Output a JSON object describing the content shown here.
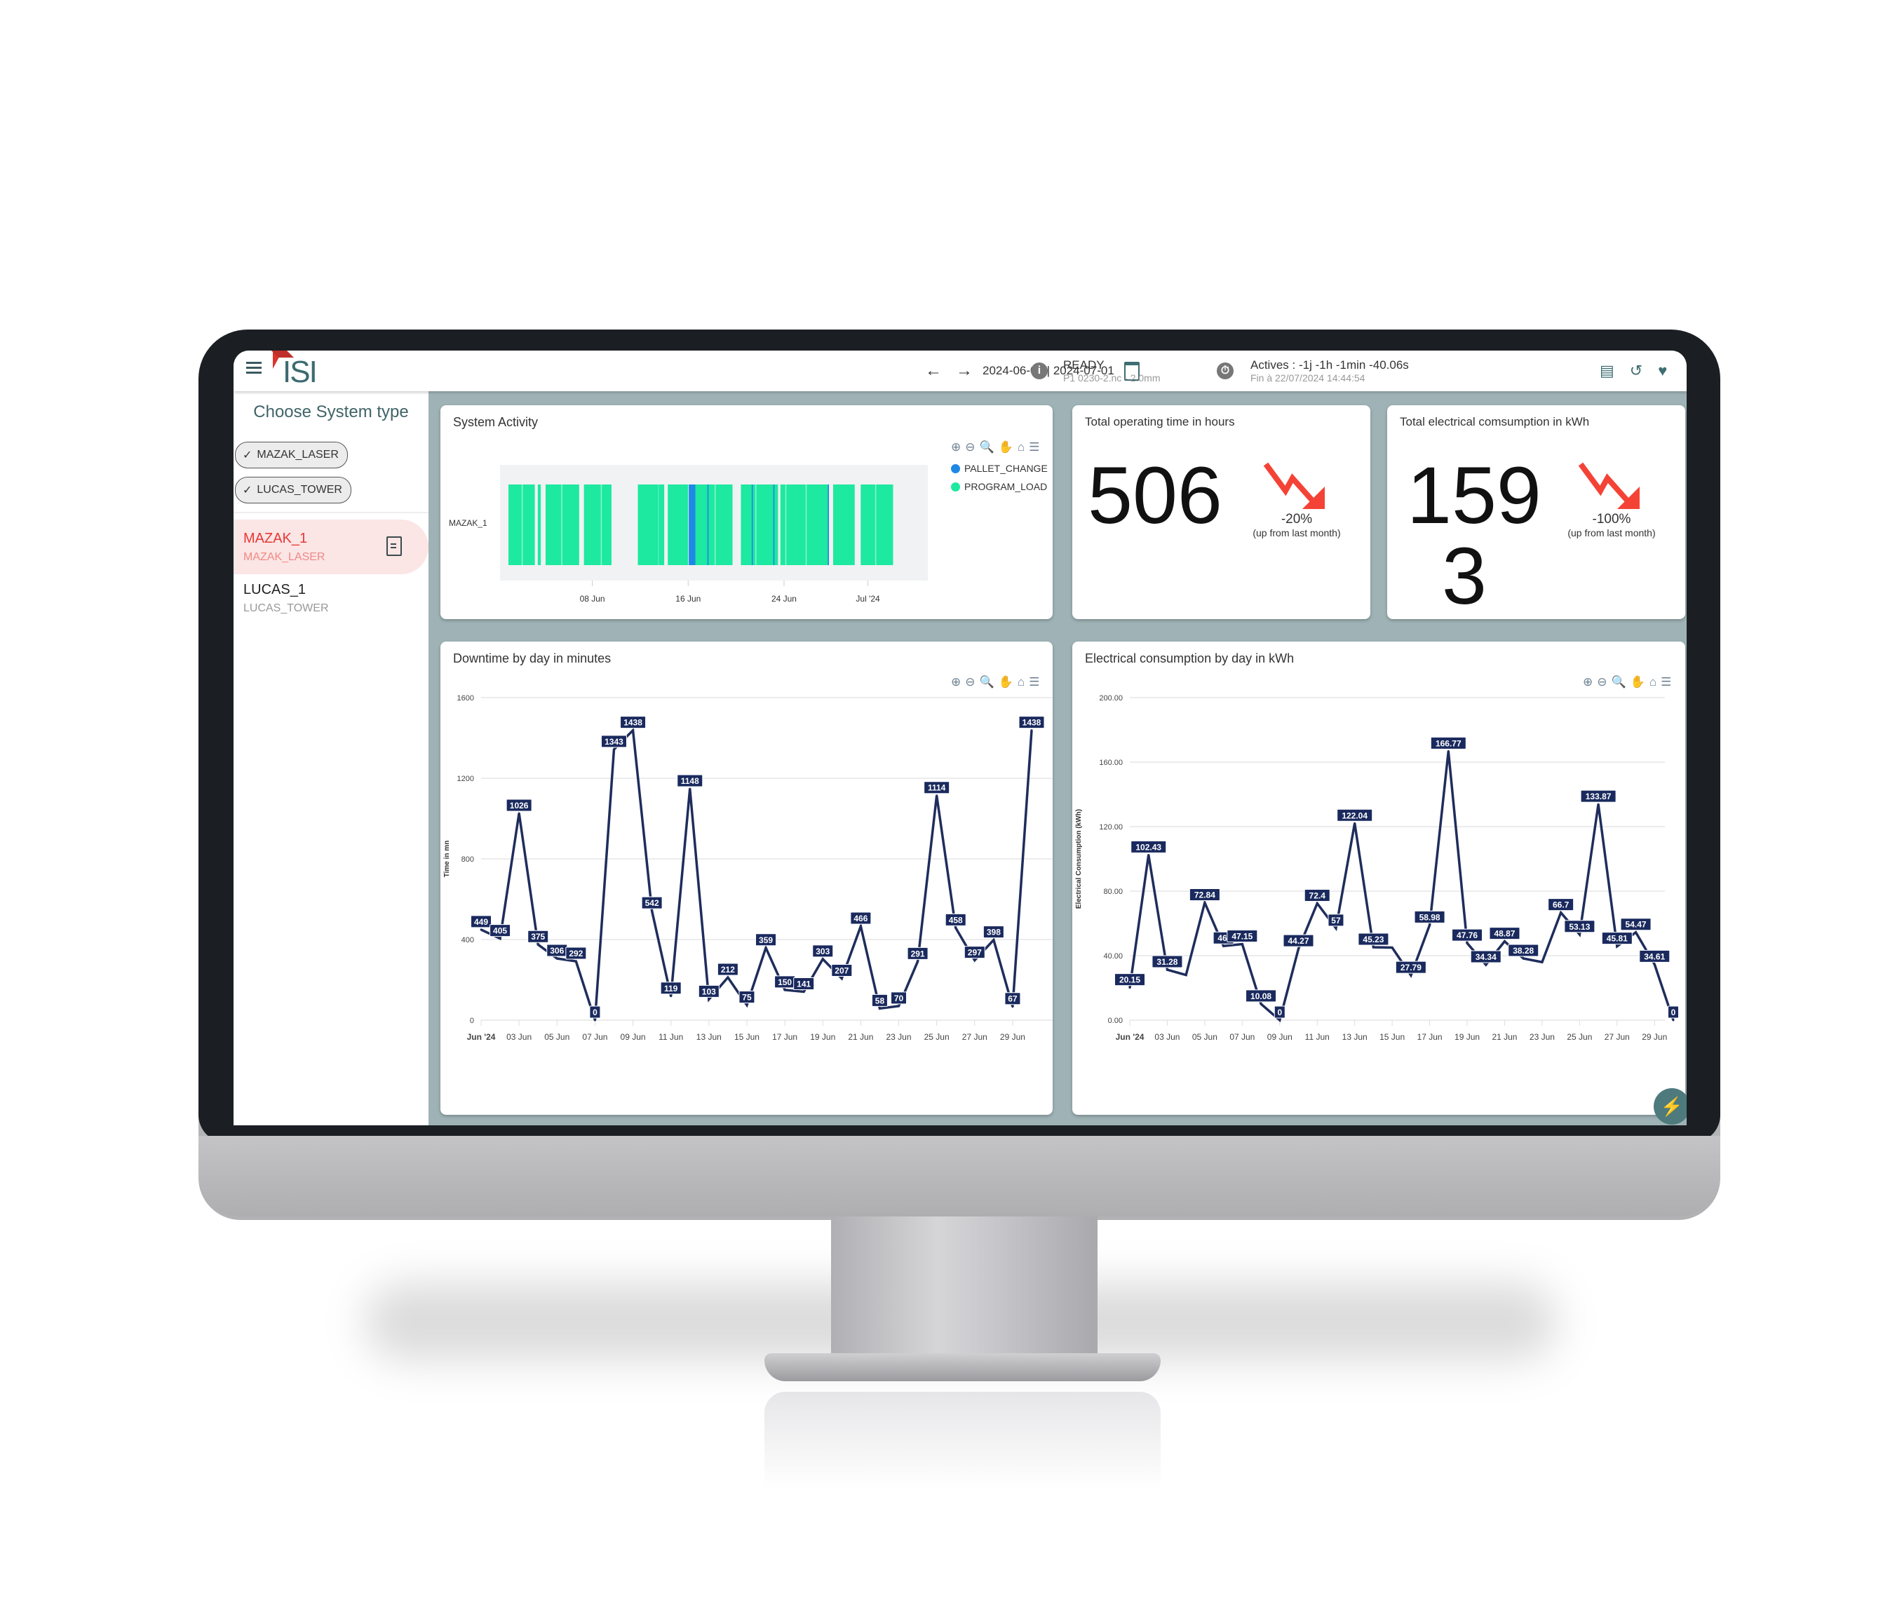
{
  "header": {
    "logo_text": "ISI",
    "date_range": "2024-06-01 | 2024-07-01",
    "status": "READY",
    "program": "P1 0230-2.nc - 2.0mm",
    "actives": "Actives : -1j -1h -1min -40.06s",
    "end_time": "Fin à 22/07/2024 14:44:54",
    "icons": [
      "menu-icon",
      "back-arrow-icon",
      "forward-arrow-icon",
      "calendar-icon",
      "info-icon",
      "timer-icon",
      "store-icon",
      "history-icon",
      "heart-pulse-icon"
    ]
  },
  "sidebar": {
    "title": "Choose System type",
    "filters": [
      {
        "label": "MAZAK_LASER",
        "checked": true
      },
      {
        "label": "LUCAS_TOWER",
        "checked": true
      }
    ],
    "systems": [
      {
        "name": "MAZAK_1",
        "type": "MAZAK_LASER",
        "active": true
      },
      {
        "name": "LUCAS_1",
        "type": "LUCAS_TOWER",
        "active": false
      }
    ]
  },
  "toolbar_icons": [
    "zoom-in-icon",
    "zoom-out-icon",
    "zoom-select-icon",
    "pan-icon",
    "reset-home-icon",
    "menu-icon"
  ],
  "system_activity": {
    "title": "System Activity",
    "row_label": "MAZAK_1",
    "x_ticks": [
      "08 Jun",
      "16 Jun",
      "24 Jun",
      "Jul '24"
    ],
    "legend": [
      {
        "label": "PALLET_CHANGE",
        "color": "#1e88e5"
      },
      {
        "label": "PROGRAM_LOAD",
        "color": "#1de9a0"
      }
    ]
  },
  "kpis": [
    {
      "title": "Total operating time in hours",
      "value": "506",
      "change": "-20%",
      "note": "(up from last month)",
      "trend_color": "#f44336"
    },
    {
      "title": "Total electrical comsumption in kWh",
      "value": "1593",
      "value_lines": [
        "159",
        "3"
      ],
      "change": "-100%",
      "note": "(up from last month)",
      "trend_color": "#f44336"
    }
  ],
  "fab": {
    "icon": "lightning-icon"
  },
  "chart_data": [
    {
      "type": "line",
      "title": "Downtime by day in minutes",
      "xlabel": "",
      "ylabel": "Time in mn",
      "ylim": [
        0,
        1600
      ],
      "y_ticks": [
        "0",
        "400",
        "800",
        "1200",
        "1600"
      ],
      "x_ticks": [
        "Jun '24",
        "03 Jun",
        "05 Jun",
        "07 Jun",
        "09 Jun",
        "11 Jun",
        "13 Jun",
        "15 Jun",
        "17 Jun",
        "19 Jun",
        "21 Jun",
        "23 Jun",
        "25 Jun",
        "27 Jun",
        "29 Jun"
      ],
      "x": [
        "01 Jun",
        "02 Jun",
        "03 Jun",
        "04 Jun",
        "05 Jun",
        "06 Jun",
        "07 Jun",
        "08 Jun",
        "09 Jun",
        "10 Jun",
        "11 Jun",
        "12 Jun",
        "13 Jun",
        "14 Jun",
        "15 Jun",
        "16 Jun",
        "17 Jun",
        "18 Jun",
        "19 Jun",
        "20 Jun",
        "21 Jun",
        "22 Jun",
        "23 Jun",
        "24 Jun",
        "25 Jun",
        "26 Jun",
        "27 Jun",
        "28 Jun",
        "29 Jun",
        "30 Jun"
      ],
      "values": [
        449,
        405,
        1026,
        375,
        306,
        292,
        0,
        1343,
        1438,
        542,
        119,
        1148,
        103,
        212,
        75,
        359,
        150,
        141,
        303,
        207,
        466,
        58,
        70,
        291,
        1114,
        458,
        297,
        398,
        67,
        1438
      ],
      "labels": [
        "449",
        "405",
        "1026",
        "375",
        "306",
        "292",
        "0",
        "1343",
        "1438",
        "542",
        "119",
        "1148",
        "103",
        "212",
        "75",
        "359",
        "150",
        "141",
        "303",
        "207",
        "466",
        "58",
        "70",
        "291",
        "1114",
        "458",
        "297",
        "398",
        "67",
        "1438"
      ],
      "line_color": "#1f2d5c",
      "grid": true
    },
    {
      "type": "line",
      "title": "Electrical consumption by day in kWh",
      "xlabel": "",
      "ylabel": "Electrical Consumption (kWh)",
      "ylim": [
        0,
        200
      ],
      "y_ticks": [
        "0.00",
        "40.00",
        "80.00",
        "120.00",
        "160.00",
        "200.00"
      ],
      "x_ticks": [
        "Jun '24",
        "03 Jun",
        "05 Jun",
        "07 Jun",
        "09 Jun",
        "11 Jun",
        "13 Jun",
        "15 Jun",
        "17 Jun",
        "19 Jun",
        "21 Jun",
        "23 Jun",
        "25 Jun",
        "27 Jun",
        "29 Jun"
      ],
      "x": [
        "01 Jun",
        "02 Jun",
        "03 Jun",
        "04 Jun",
        "05 Jun",
        "06 Jun",
        "07 Jun",
        "08 Jun",
        "09 Jun",
        "10 Jun",
        "11 Jun",
        "12 Jun",
        "13 Jun",
        "14 Jun",
        "15 Jun",
        "16 Jun",
        "17 Jun",
        "18 Jun",
        "19 Jun",
        "20 Jun",
        "21 Jun",
        "22 Jun",
        "23 Jun",
        "24 Jun",
        "25 Jun",
        "26 Jun",
        "27 Jun",
        "28 Jun",
        "29 Jun",
        "30 Jun"
      ],
      "values": [
        20.15,
        102.43,
        31.28,
        28,
        72.84,
        46,
        47.15,
        10.08,
        0,
        44.27,
        72.4,
        57,
        122.04,
        45.23,
        45,
        27.79,
        58.98,
        166.77,
        47.76,
        34.34,
        48.87,
        38.28,
        36,
        66.7,
        53.13,
        133.87,
        45.81,
        54.47,
        34.61,
        0
      ],
      "labels": [
        "20.15",
        "102.43",
        "31.28",
        "",
        "72.84",
        "46.",
        "47.15",
        "10.08",
        "0",
        "44.27",
        "72.4",
        "57",
        "122.04",
        "45.23",
        "",
        "27.79",
        "58.98",
        "166.77",
        "47.76",
        "34.34",
        "48.87",
        "38.28",
        "",
        "66.7",
        "53.13",
        "133.87",
        "45.81",
        "54.47",
        "34.61",
        "0"
      ],
      "line_color": "#1f2d5c",
      "grid": true
    }
  ]
}
